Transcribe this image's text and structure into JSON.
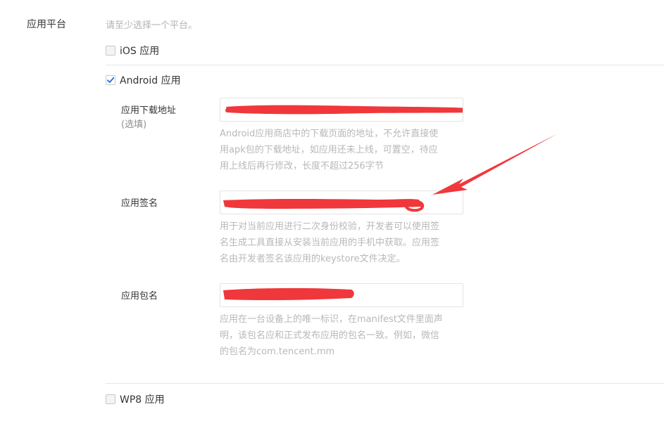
{
  "section": {
    "label": "应用平台",
    "hint": "请至少选择一个平台。"
  },
  "platforms": {
    "ios": {
      "label": "iOS 应用",
      "checked": false
    },
    "android": {
      "label": "Android 应用",
      "checked": true
    },
    "wp8": {
      "label": "WP8 应用",
      "checked": false
    }
  },
  "android_form": {
    "download_url": {
      "label": "应用下载地址",
      "sublabel": "(选填)",
      "value": "",
      "desc_lines": [
        "Android应用商店中的下载页面的地址，不允许直接使",
        "用apk包的下载地址，如应用还未上线，可置空，待应",
        "用上线后再行修改，长度不超过256字节"
      ]
    },
    "signature": {
      "label": "应用签名",
      "value": "",
      "desc_lines": [
        "用于对当前应用进行二次身份校验，开发者可以使用签",
        "名生成工具直接从安装当前应用的手机中获取。应用签",
        "名由开发者签名该应用的keystore文件决定。"
      ]
    },
    "package_name": {
      "label": "应用包名",
      "value": "",
      "desc_lines": [
        "应用在一台设备上的唯一标识，在manifest文件里面声",
        "明，该包名应和正式发布应用的包名一致。例如，微信",
        "的包名为com.tencent.mm"
      ]
    }
  },
  "colors": {
    "redaction": "#f0373b",
    "check": "#2e7be0"
  }
}
